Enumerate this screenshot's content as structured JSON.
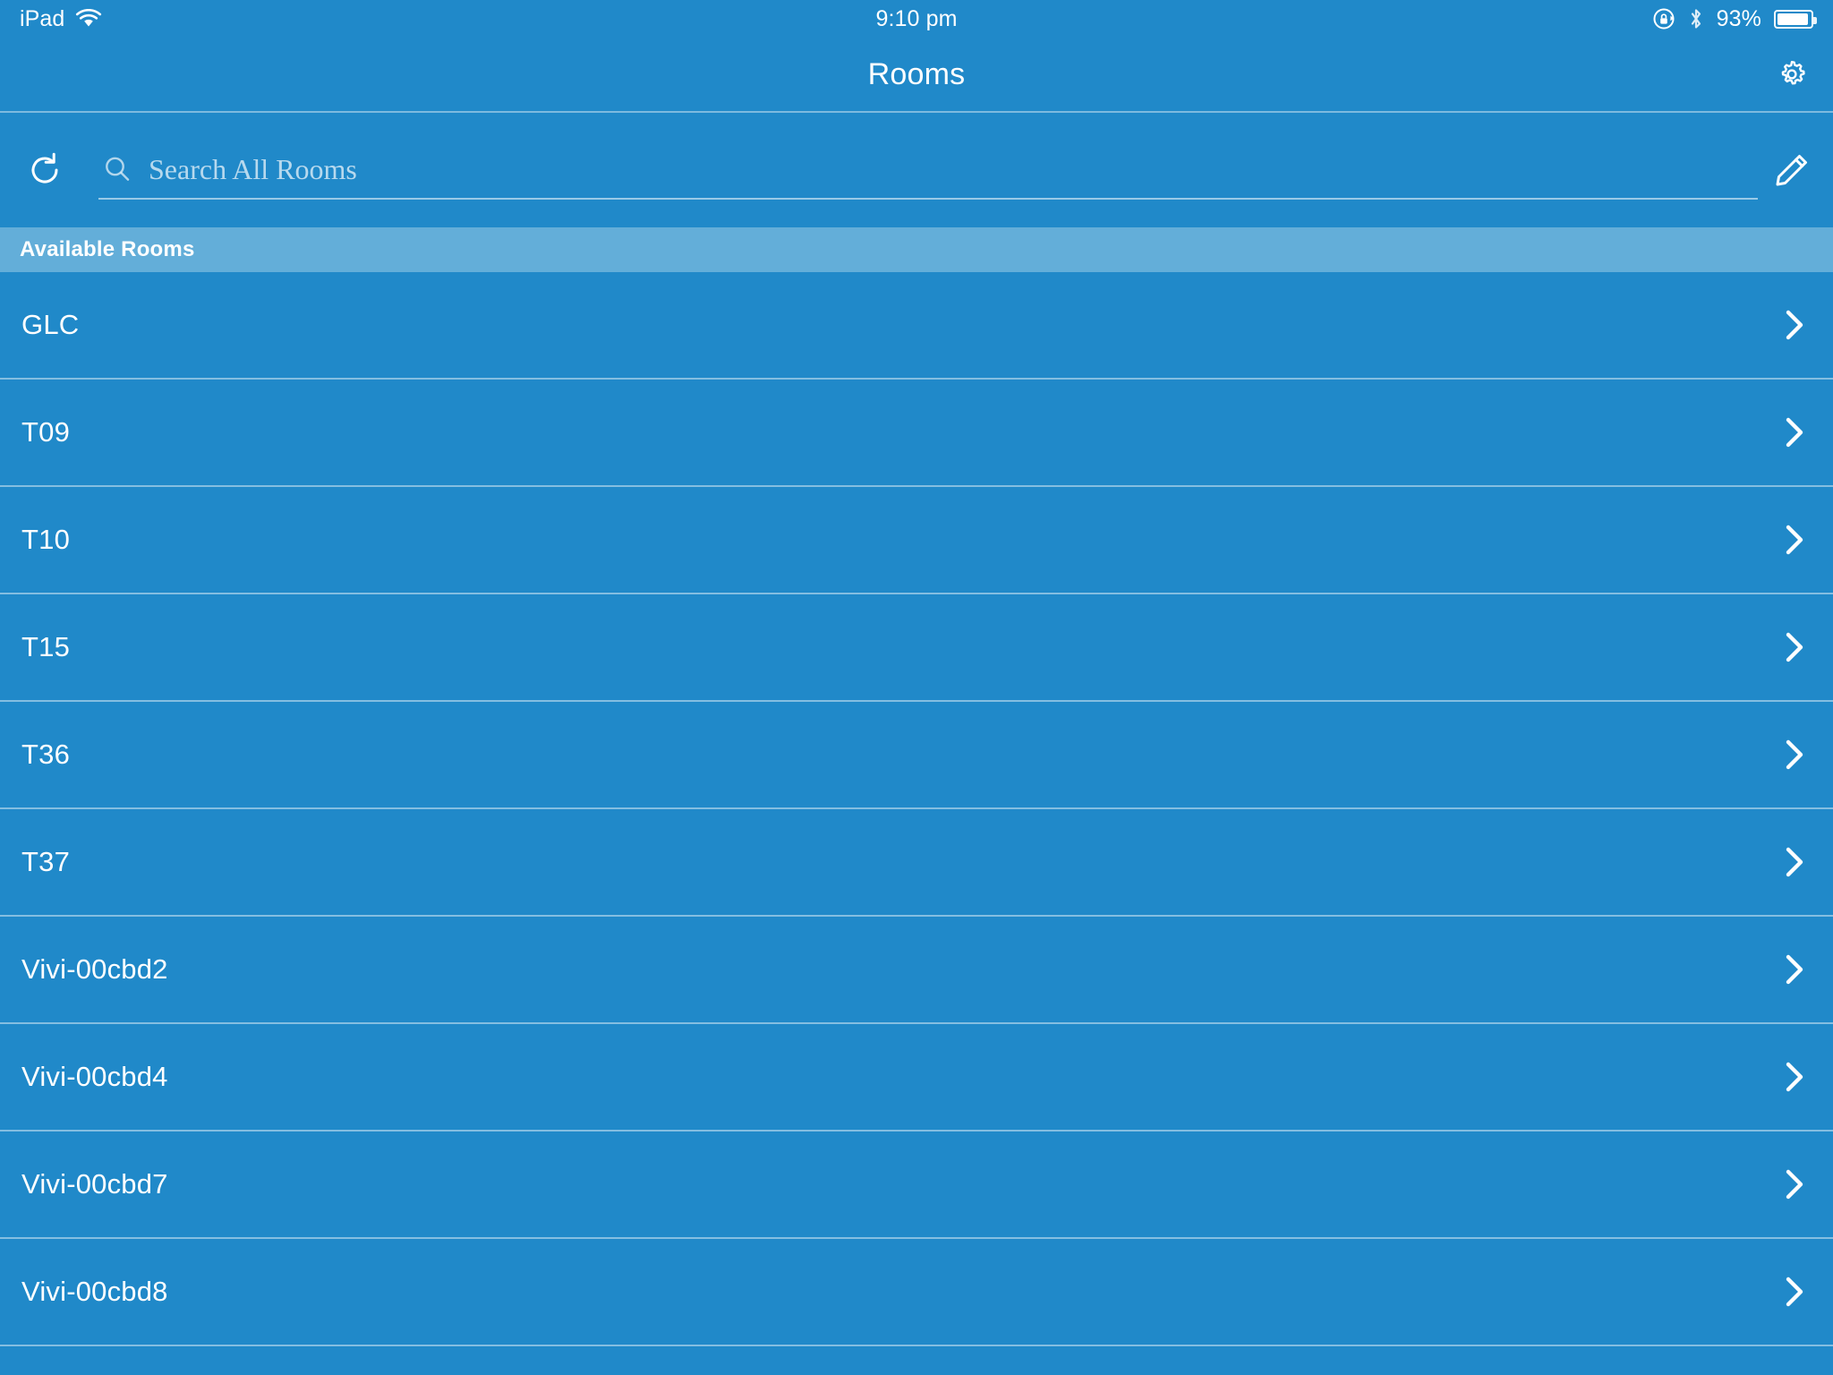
{
  "colors": {
    "background": "#2089c9",
    "section_header_bg": "#63aed9",
    "text": "#ffffff",
    "divider": "rgba(255,255,255,0.45)"
  },
  "status_bar": {
    "device_label": "iPad",
    "wifi_icon": "wifi-icon",
    "time": "9:10 pm",
    "rotation_lock_icon": "rotation-lock-icon",
    "bluetooth_icon": "bluetooth-icon",
    "battery_percent": "93%",
    "battery_icon": "battery-icon",
    "battery_level": 93
  },
  "nav_bar": {
    "title": "Rooms",
    "settings_icon": "gear-icon"
  },
  "search_bar": {
    "refresh_icon": "refresh-icon",
    "search_icon": "search-icon",
    "placeholder": "Search All Rooms",
    "value": "",
    "edit_icon": "pencil-icon"
  },
  "sections": [
    {
      "header": "Available Rooms",
      "rows": [
        {
          "label": "GLC",
          "accessory_icon": "chevron-right-icon"
        },
        {
          "label": "T09",
          "accessory_icon": "chevron-right-icon"
        },
        {
          "label": "T10",
          "accessory_icon": "chevron-right-icon"
        },
        {
          "label": "T15",
          "accessory_icon": "chevron-right-icon"
        },
        {
          "label": "T36",
          "accessory_icon": "chevron-right-icon"
        },
        {
          "label": "T37",
          "accessory_icon": "chevron-right-icon"
        },
        {
          "label": "Vivi-00cbd2",
          "accessory_icon": "chevron-right-icon"
        },
        {
          "label": "Vivi-00cbd4",
          "accessory_icon": "chevron-right-icon"
        },
        {
          "label": "Vivi-00cbd7",
          "accessory_icon": "chevron-right-icon"
        },
        {
          "label": "Vivi-00cbd8",
          "accessory_icon": "chevron-right-icon"
        }
      ]
    }
  ]
}
